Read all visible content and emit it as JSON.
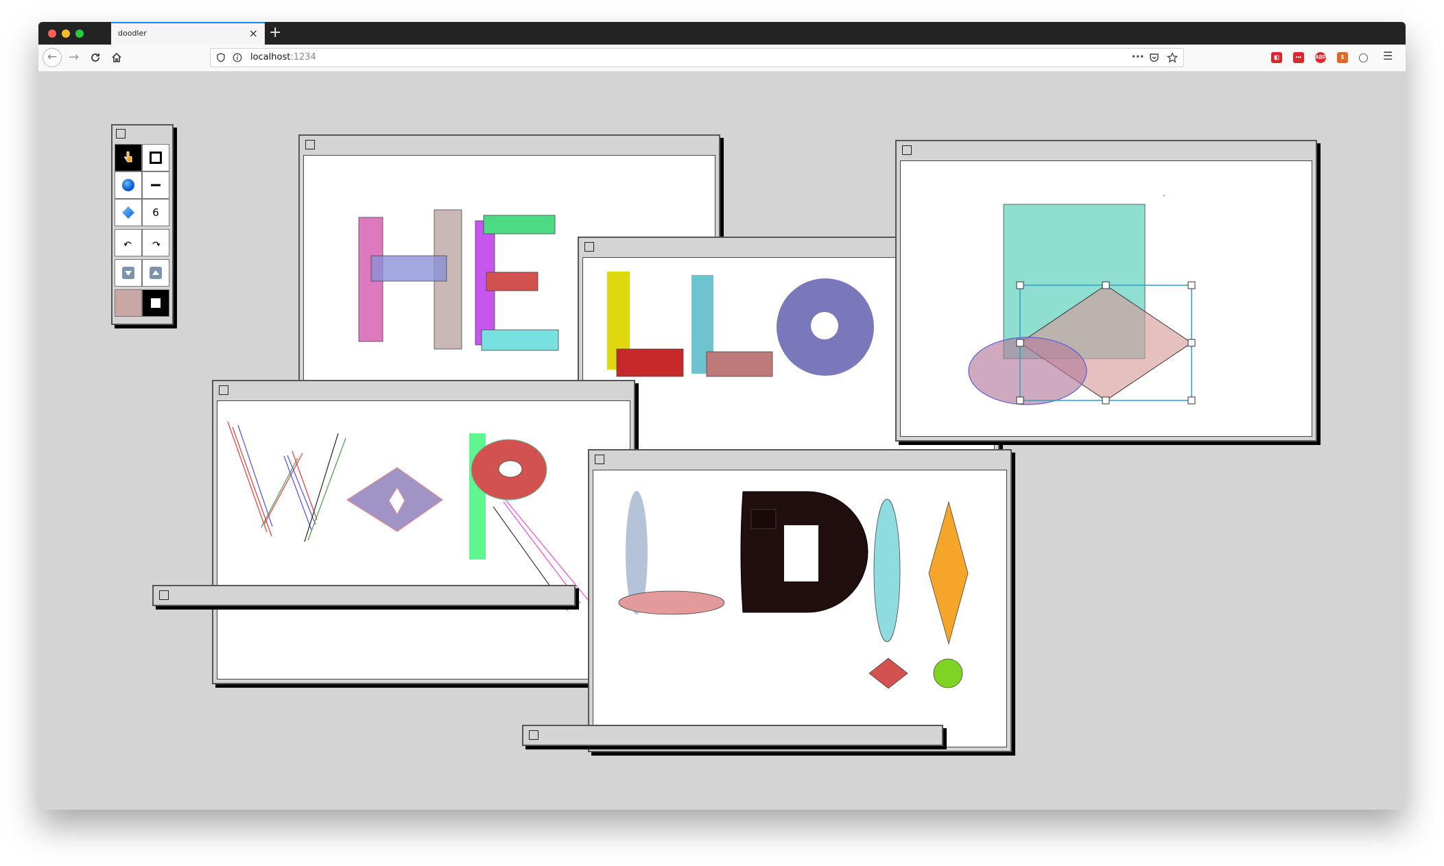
{
  "browser": {
    "tab_title": "doodler",
    "tab_close_icon": "×",
    "new_tab_icon": "+",
    "url_host": "localhost",
    "url_port": ":1234",
    "more_icon": "•••"
  },
  "toolbar": {
    "stroke_width_value": "6",
    "fill_color": "#c8a7a4",
    "stroke_color": "#000000"
  },
  "colors": {
    "desktop": "#d4d4d4",
    "window_chrome": "#d4d4d4",
    "selection": "#2b9fc8"
  }
}
